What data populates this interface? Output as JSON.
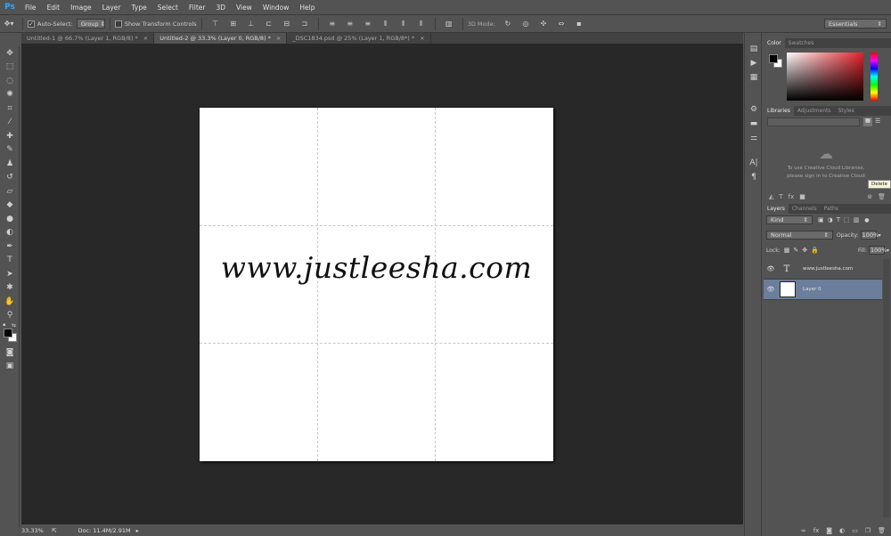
{
  "app": {
    "logo": "Ps"
  },
  "menu": [
    "File",
    "Edit",
    "Image",
    "Layer",
    "Type",
    "Select",
    "Filter",
    "3D",
    "View",
    "Window",
    "Help"
  ],
  "options": {
    "auto_select_label": "Auto-Select:",
    "auto_select_value": "Group",
    "transform_label": "Show Transform Controls",
    "mode_label": "3D Mode:",
    "workspace": "Essentials"
  },
  "tabs": [
    {
      "label": "Untitled-1 @ 66.7% (Layer 1, RGB/8) *",
      "close": "×"
    },
    {
      "label": "Untitled-2 @ 33.3% (Layer 0, RGB/8) *",
      "close": "×"
    },
    {
      "label": "_DSC1834.psd @ 25% (Layer 1, RGB/8*) *",
      "close": "×"
    }
  ],
  "canvas": {
    "text": "www.justleesha.com"
  },
  "status": {
    "zoom": "33.33%",
    "doc": "Doc: 11.4M/2.91M"
  },
  "color_panel": {
    "tabs": [
      "Color",
      "Swatches"
    ]
  },
  "libraries": {
    "tabs": [
      "Libraries",
      "Adjustments",
      "Styles"
    ],
    "message": "To use Creative Cloud Libraries, please sign in to Creative Cloud",
    "tooltip": "Delete"
  },
  "layers_panel": {
    "tabs": [
      "Layers",
      "Channels",
      "Paths"
    ],
    "kind": "Kind",
    "blend_mode": "Normal",
    "opacity_label": "Opacity:",
    "opacity_value": "100%",
    "lock_label": "Lock:",
    "fill_label": "Fill:",
    "fill_value": "100%",
    "layers": [
      {
        "name": "www.justleesha.com",
        "type": "text"
      },
      {
        "name": "Layer 0",
        "type": "pixel"
      }
    ]
  },
  "colors": {
    "accent": "#31a8ff",
    "selected_layer": "#6b7f9c",
    "canvas_bg": "#282828",
    "ui_bg": "#535353"
  }
}
